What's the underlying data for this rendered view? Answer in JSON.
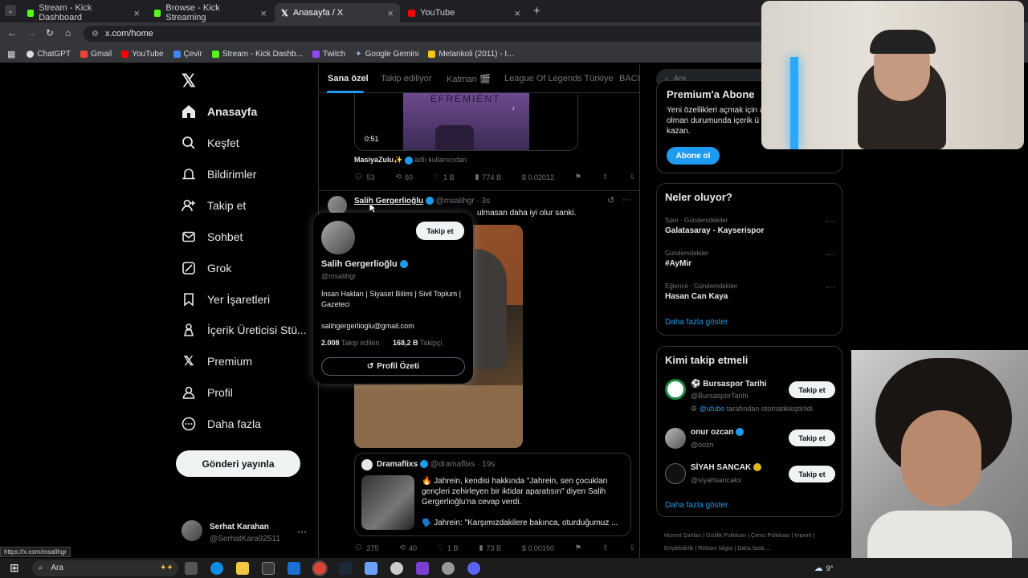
{
  "browser": {
    "tabs": [
      {
        "label": "Stream - Kick Dashboard",
        "color": "#53fc18"
      },
      {
        "label": "Browse - Kick Streaming",
        "color": "#53fc18"
      },
      {
        "label": "Anasayfa / X",
        "color": "#ffffff"
      },
      {
        "label": "YouTube",
        "color": "#ff0000"
      }
    ],
    "url": "x.com/home",
    "bookmarks": [
      "ChatGPT",
      "Gmail",
      "YouTube",
      "Çevir",
      "Stream - Kick Dashb...",
      "Twitch",
      "Google Gemini",
      "Melankoli (2011) - I..."
    ],
    "status_url": "https://x.com/msalihgr"
  },
  "nav": {
    "items": [
      "Anasayfa",
      "Keşfet",
      "Bildirimler",
      "Takip et",
      "Sohbet",
      "Grok",
      "Yer İşaretleri",
      "İçerik Üreticisi Stü...",
      "Premium",
      "Profil",
      "Daha fazla"
    ],
    "post_button": "Gönderi yayınla",
    "user_name": "Serhat Karahan",
    "user_handle": "@SerhatKara92511"
  },
  "feed": {
    "tabs": [
      "Sana özel",
      "Takip ediliyor",
      "Katman 🎬",
      "League Of Legends Türkiye",
      "BACIL"
    ],
    "video_duration": "0:51",
    "video_caption": "EFREMIENT",
    "tweet1": {
      "source_name": "MasiyaZulu✨",
      "source_suffix": "adlı kullanıcıdan",
      "replies": "53",
      "reposts": "60",
      "likes": "1 B",
      "views": "774 B",
      "earnings": "$ 0.02012"
    },
    "tweet2": {
      "name": "Salih Gergerlioğlu",
      "handle": "@msalihgr",
      "time": "· 3s",
      "text": "S... ...ulmasan daha iyi olur sanki.",
      "text_visible": "ulmasan daha iyi olur sanki.",
      "quote": {
        "name": "Dramaflixs",
        "handle": "@dramaflixs",
        "time": "· 19s",
        "text": "🔥 Jahrein, kendisi hakkında \"Jahrein, sen çocukları gençleri zehirleyen bir iktidar aparatısın\" diyen Salih Gergerlioğlu'na cevap verdi.",
        "text2": "🗣️ Jahrein: \"Karşımızdakilere bakınca, oturduğumuz ..."
      },
      "replies": "275",
      "reposts": "40",
      "likes": "1 B",
      "views": "73 B",
      "earnings": "$ 0.00190"
    }
  },
  "popup": {
    "follow_label": "Takip et",
    "name": "Salih Gergerlioğlu",
    "handle": "@msalihgr",
    "bio": "İnsan Hakları | Siyaset Bilimi | Sivil Toplum | Gazeteci",
    "email": "salihgergerlioglu@gmail.com",
    "following_count": "2.008",
    "following_label": "Takip edilen",
    "followers_count": "168,2 B",
    "followers_label": "Takipçi",
    "profile_summary": "Profil Özeti"
  },
  "right": {
    "search_placeholder": "Ara",
    "premium": {
      "title": "Premium'a Abone",
      "text": "Yeni özellikleri açmak için a... olman durumunda içerik ü... kazan.",
      "line1": "Yeni özellikleri açmak için a",
      "line2": "olman durumunda içerik ü",
      "line3": "kazan.",
      "button": "Abone ol"
    },
    "trends": {
      "title": "Neler oluyor?",
      "items": [
        {
          "context": "Spor · Gündemdekiler",
          "title": "Galatasaray - Kayserispor"
        },
        {
          "context": "Gündemdekiler",
          "title": "#AyMir"
        },
        {
          "context": "Eğlence · Gündemdekiler",
          "title": "Hasan Can Kaya"
        }
      ],
      "more": "Daha fazla göster"
    },
    "who_to_follow": {
      "title": "Kimi takip etmeli",
      "items": [
        {
          "name": "⚽ Bursaspor Tarihi",
          "handle": "@BursasporTarihi",
          "note_handle": "@ufubo",
          "note": "tarafından otomatikleştirildi",
          "button": "Takip et"
        },
        {
          "name": "onur ozcan",
          "handle": "@oozn",
          "button": "Takip et"
        },
        {
          "name": "SİYAH SANCAK",
          "handle": "@siyahsancakx",
          "button": "Takip et"
        }
      ],
      "more": "Daha fazla göster"
    },
    "footer": [
      "Hizmet Şartları",
      "Gizlilik Politikası",
      "Çerez Politikası",
      "Imprint",
      "Erişilebilirlik",
      "Reklam bilgisi",
      "Daha fazla ..."
    ]
  },
  "taskbar": {
    "search": "Ara",
    "temp": "9°"
  }
}
